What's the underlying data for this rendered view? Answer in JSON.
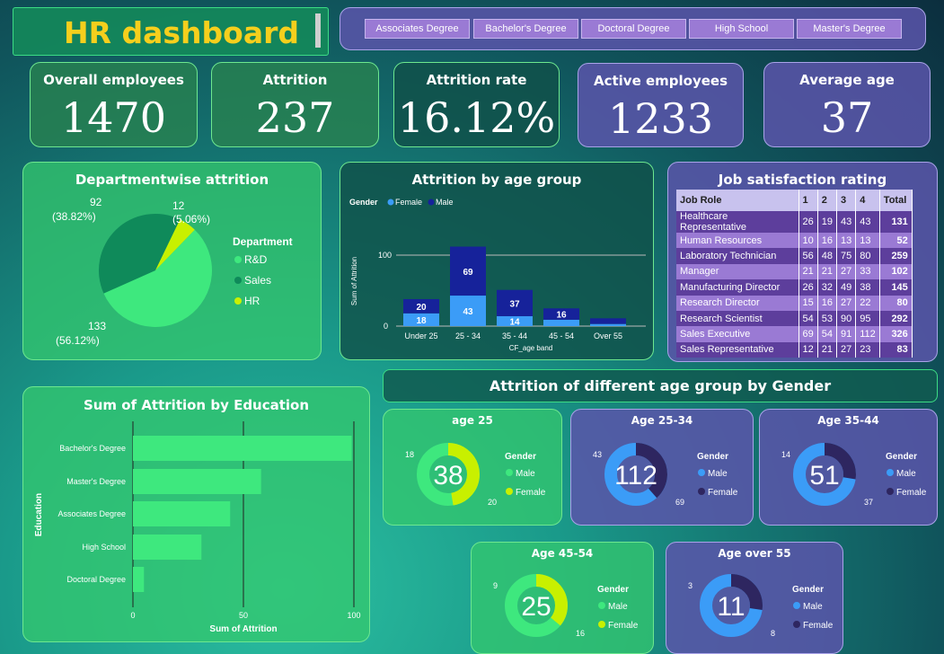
{
  "title": "HR dashboard",
  "education_slicer": [
    "Associates Degree",
    "Bachelor's Degree",
    "Doctoral Degree",
    "High School",
    "Master's Degree"
  ],
  "kpis": {
    "overall": {
      "label": "Overall employees",
      "value": "1470"
    },
    "attrition": {
      "label": "Attrition",
      "value": "237"
    },
    "rate": {
      "label": "Attrition rate",
      "value": "16.12%"
    },
    "active": {
      "label": "Active employees",
      "value": "1233"
    },
    "age": {
      "label": "Average age",
      "value": "37"
    }
  },
  "colors": {
    "accent_title": "#f5cf1d",
    "green": "#3ee87e",
    "dark_green": "#0f8a5a",
    "lime": "#c8f000",
    "blue": "#3b9cf7",
    "navy": "#16229a",
    "dark_purple": "#2e2660"
  },
  "dept": {
    "title": "Departmentwise attrition",
    "legend_title": "Department",
    "legend": [
      "R&D",
      "Sales",
      "HR"
    ],
    "labels": {
      "sales_count": "92",
      "sales_pct": "(38.82%)",
      "hr_count": "12",
      "hr_pct": "(5.06%)",
      "rd_count": "133",
      "rd_pct": "(56.12%)"
    }
  },
  "age_group": {
    "title": "Attrition by age group",
    "legend_title": "Gender",
    "legend": [
      "Female",
      "Male"
    ],
    "y_axis_label": "Sum of Attrition",
    "x_axis_label": "CF_age band",
    "y_ticks": [
      "0",
      "100"
    ]
  },
  "job_sat": {
    "title": "Job satisfaction rating",
    "headers": [
      "Job Role",
      "1",
      "2",
      "3",
      "4",
      "Total"
    ],
    "rows": [
      [
        "Healthcare Representative",
        "26",
        "19",
        "43",
        "43",
        "131"
      ],
      [
        "Human Resources",
        "10",
        "16",
        "13",
        "13",
        "52"
      ],
      [
        "Laboratory Technician",
        "56",
        "48",
        "75",
        "80",
        "259"
      ],
      [
        "Manager",
        "21",
        "21",
        "27",
        "33",
        "102"
      ],
      [
        "Manufacturing Director",
        "26",
        "32",
        "49",
        "38",
        "145"
      ],
      [
        "Research Director",
        "15",
        "16",
        "27",
        "22",
        "80"
      ],
      [
        "Research Scientist",
        "54",
        "53",
        "90",
        "95",
        "292"
      ],
      [
        "Sales Executive",
        "69",
        "54",
        "91",
        "112",
        "326"
      ],
      [
        "Sales Representative",
        "12",
        "21",
        "27",
        "23",
        "83"
      ]
    ]
  },
  "edu": {
    "title": "Sum of Attrition by Education",
    "y_axis_label": "Education",
    "x_axis_label": "Sum of Attrition",
    "x_ticks": [
      "0",
      "50",
      "100"
    ]
  },
  "gender_section": {
    "title": "Attrition of different age group by Gender",
    "legend_title": "Gender",
    "male": "Male",
    "female": "Female"
  },
  "donuts": [
    {
      "title": "age 25",
      "center": "38",
      "female": 18,
      "male": 20
    },
    {
      "title": "Age 25-34",
      "center": "112",
      "female": 43,
      "male": 69
    },
    {
      "title": "Age 35-44",
      "center": "51",
      "female": 14,
      "male": 37
    },
    {
      "title": "Age 45-54",
      "center": "25",
      "female": 9,
      "male": 16
    },
    {
      "title": "Age over 55",
      "center": "11",
      "female": 3,
      "male": 8
    }
  ],
  "chart_data": [
    {
      "type": "pie",
      "title": "Departmentwise attrition",
      "categories": [
        "R&D",
        "Sales",
        "HR"
      ],
      "values": [
        133,
        92,
        12
      ],
      "percent": [
        56.12,
        38.82,
        5.06
      ]
    },
    {
      "type": "bar",
      "stacked": true,
      "title": "Attrition by age group",
      "categories": [
        "Under 25",
        "25 - 34",
        "35 - 44",
        "45 - 54",
        "Over 55"
      ],
      "series": [
        {
          "name": "Female",
          "values": [
            18,
            43,
            14,
            9,
            3
          ]
        },
        {
          "name": "Male",
          "values": [
            20,
            69,
            37,
            16,
            8
          ]
        }
      ],
      "xlabel": "CF_age band",
      "ylabel": "Sum of Attrition",
      "ylim": [
        0,
        120
      ]
    },
    {
      "type": "bar",
      "orientation": "horizontal",
      "title": "Sum of Attrition by Education",
      "categories": [
        "Bachelor's Degree",
        "Master's Degree",
        "Associates Degree",
        "High School",
        "Doctoral Degree"
      ],
      "values": [
        99,
        58,
        44,
        31,
        5
      ],
      "xlabel": "Sum of Attrition",
      "ylabel": "Education",
      "xlim": [
        0,
        100
      ]
    }
  ]
}
